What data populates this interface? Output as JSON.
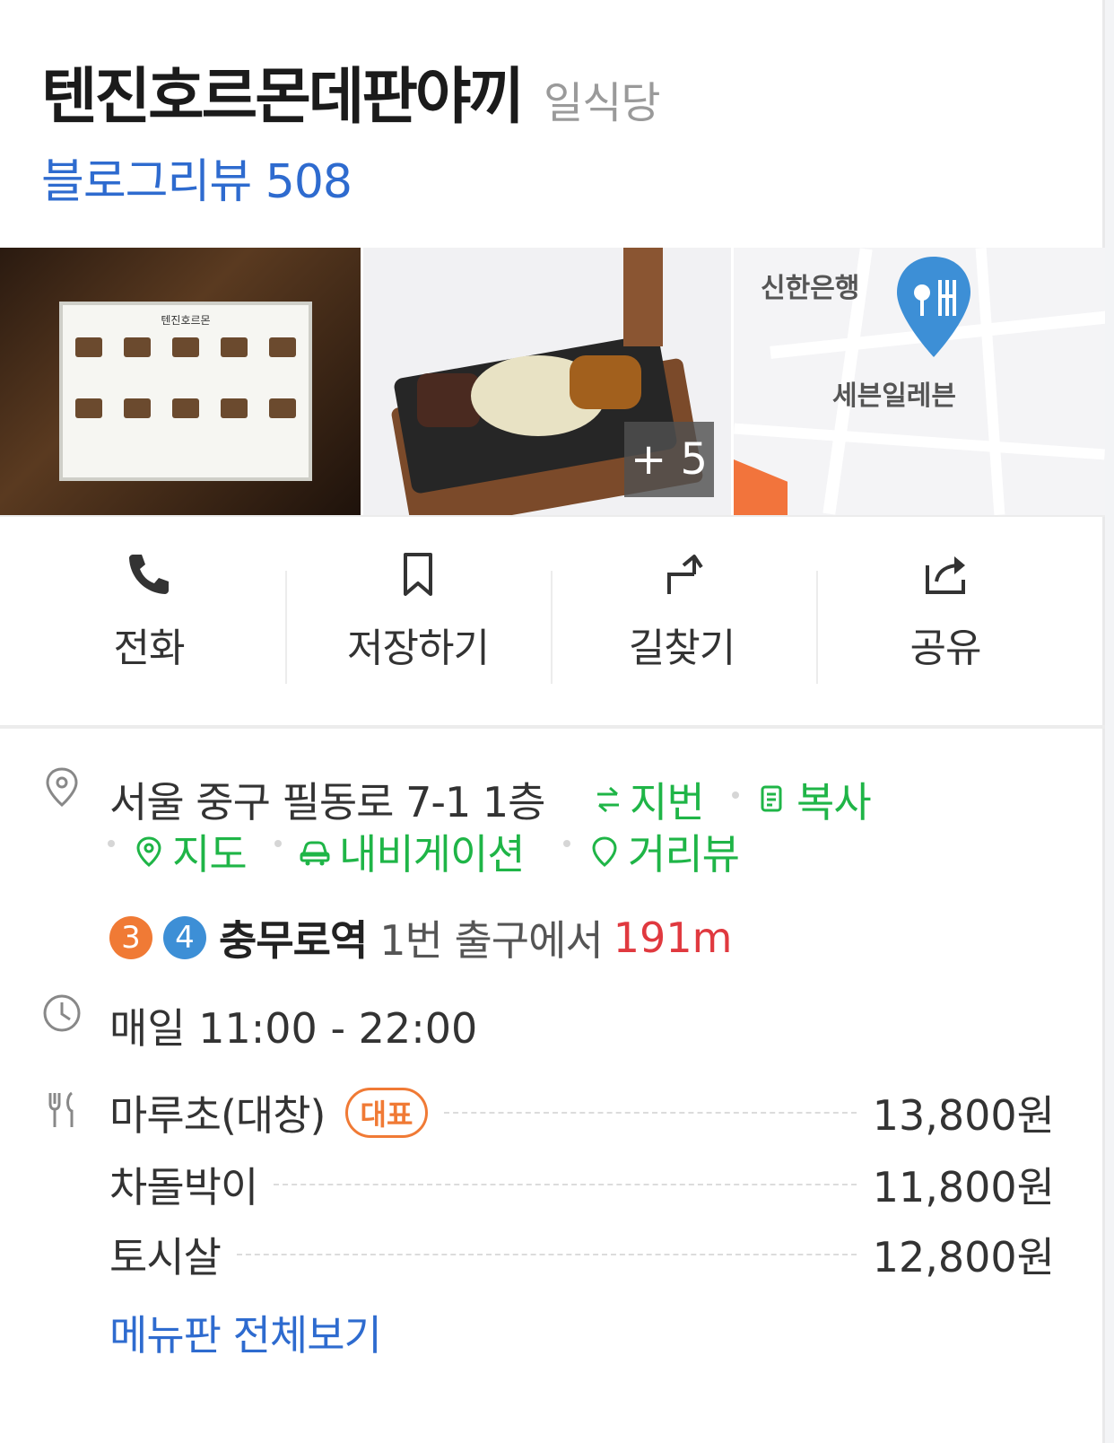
{
  "place": {
    "name": "텐진호르몬데판야끼",
    "category": "일식당",
    "blog_review": "블로그리뷰 508"
  },
  "photos": {
    "more_count": "+ 5",
    "map_labels": {
      "bank": "신한은행",
      "store": "세븐일레븐"
    },
    "menu_board_title": "텐진호르몬"
  },
  "actions": [
    {
      "label": "전화",
      "icon": "phone-icon"
    },
    {
      "label": "저장하기",
      "icon": "bookmark-icon"
    },
    {
      "label": "길찾기",
      "icon": "directions-icon"
    },
    {
      "label": "공유",
      "icon": "share-icon"
    }
  ],
  "address": {
    "text": "서울 중구 필동로 7-1 1층",
    "jibun": "지번",
    "copy": "복사",
    "map": "지도",
    "navigation": "내비게이션",
    "street_view": "거리뷰"
  },
  "subway": {
    "lines": [
      {
        "number": "3",
        "color": "#f07a35"
      },
      {
        "number": "4",
        "color": "#3d8fd6"
      }
    ],
    "station": "충무로역",
    "exit_text": "1번 출구에서",
    "distance": "191m"
  },
  "hours": "매일 11:00 - 22:00",
  "menu": {
    "items": [
      {
        "name": "마루초(대창)",
        "badge": "대표",
        "price": "13,800원"
      },
      {
        "name": "차돌박이",
        "price": "11,800원"
      },
      {
        "name": "토시살",
        "price": "12,800원"
      }
    ],
    "more": "메뉴판 전체보기"
  },
  "colors": {
    "link_blue": "#2e6bcf",
    "green": "#1fb547",
    "distance_red": "#e0393f",
    "badge_orange": "#f07a35"
  }
}
